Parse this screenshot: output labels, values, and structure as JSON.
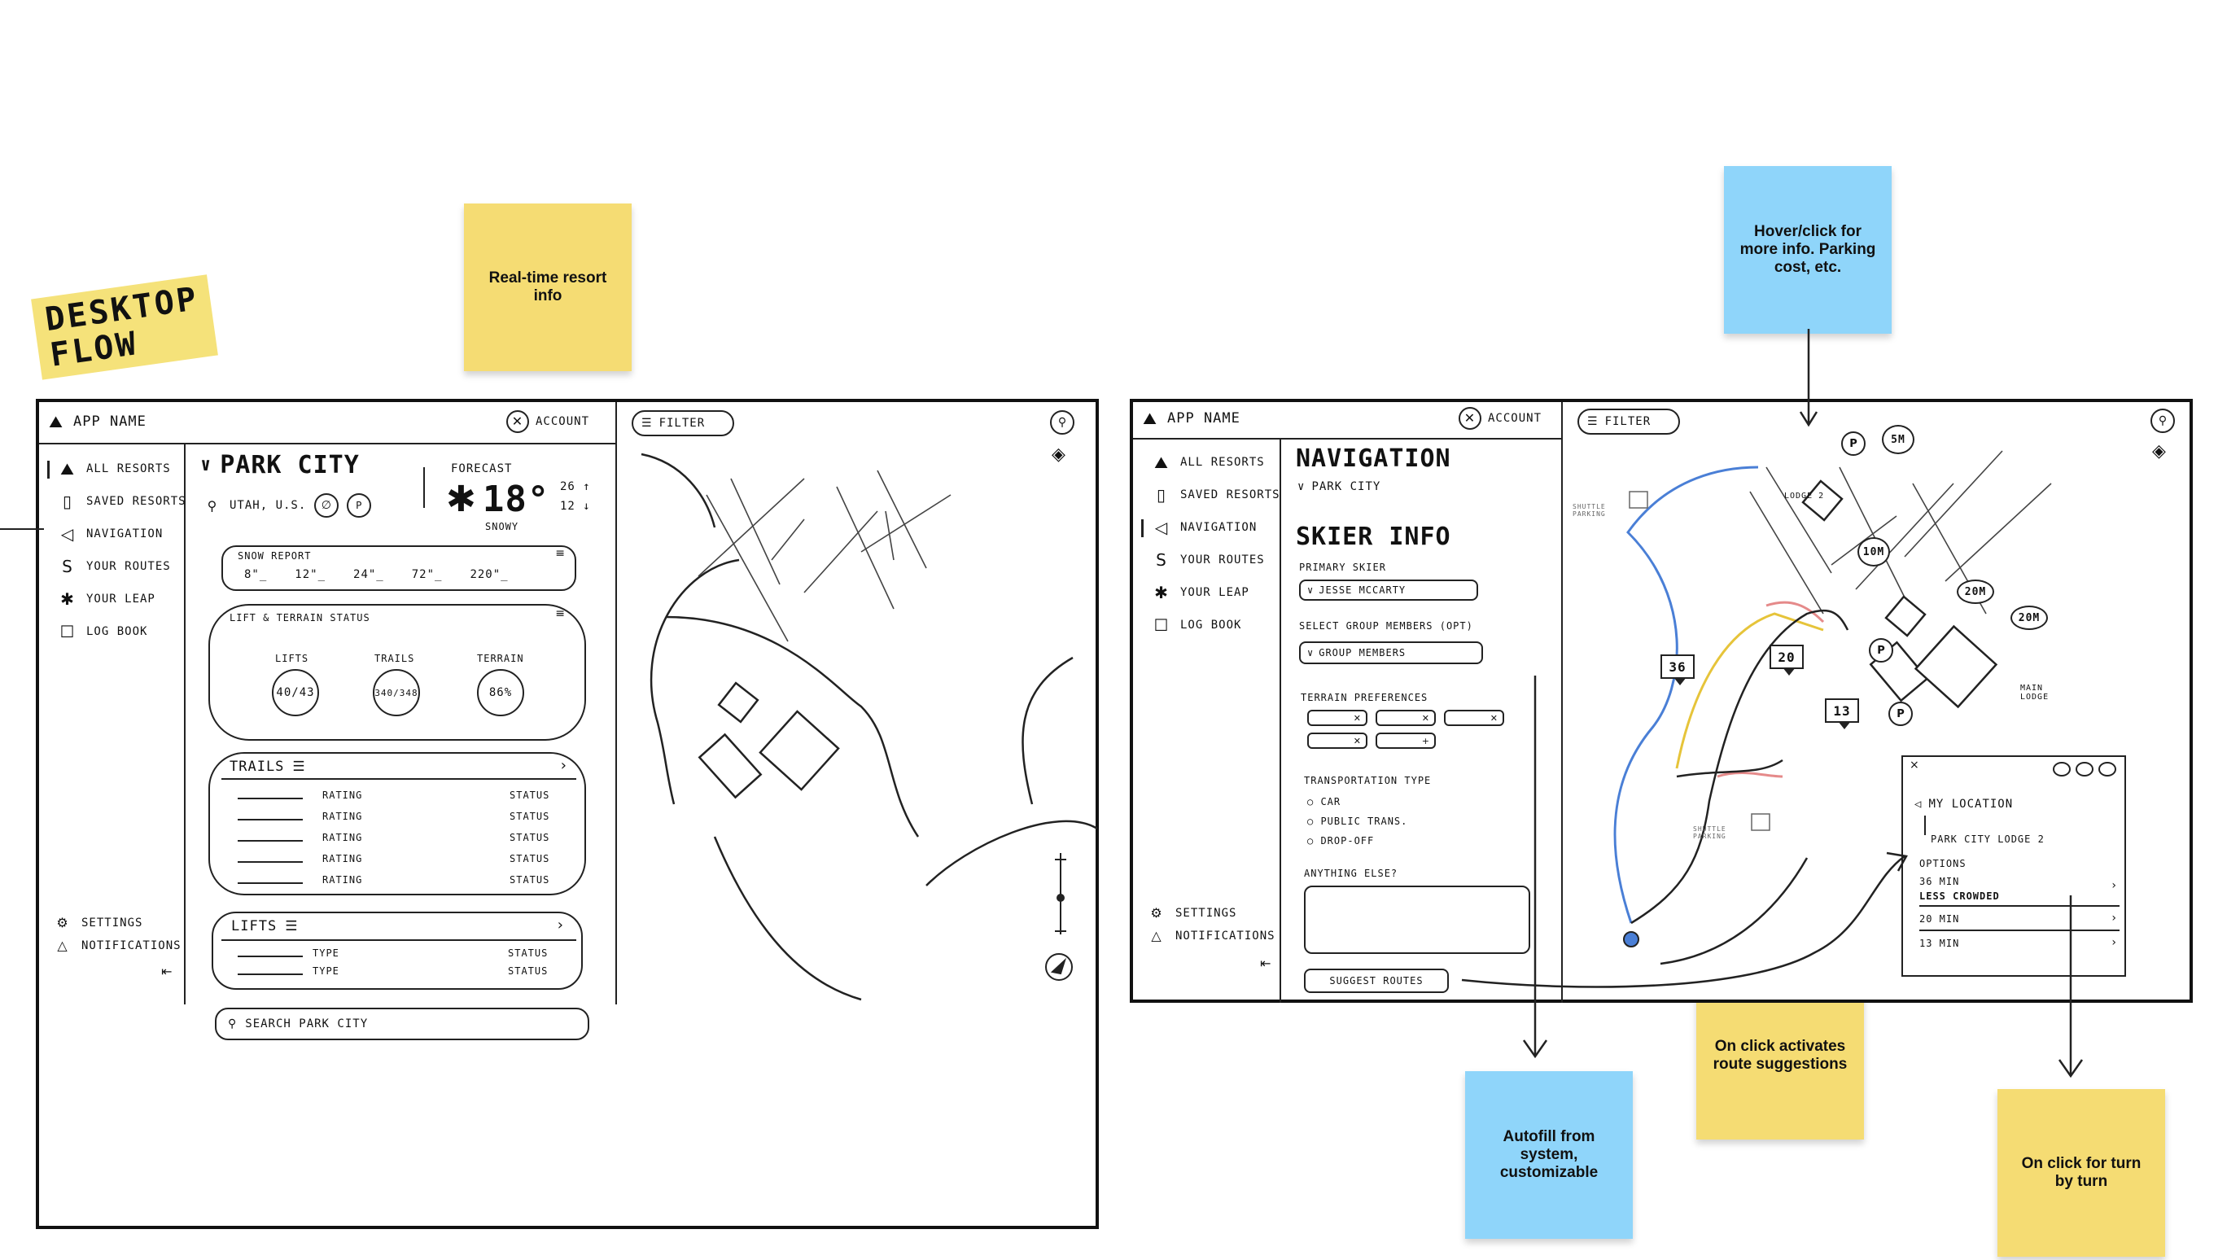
{
  "title": {
    "line1": "DESKTOP",
    "line2": "FLOW"
  },
  "sticky_notes": {
    "realtime": "Real-time resort info",
    "hover": "Hover/click for more info. Parking cost, etc.",
    "autofill": "Autofill from system, customizable",
    "route": "On click activates route suggestions",
    "turn": "On click for turn by turn"
  },
  "colors": {
    "sticky_yellow": "#f5dc73",
    "sticky_blue": "#8fd5fa",
    "route_blue": "#4a7fd6",
    "route_yellow": "#e6c43a",
    "route_red": "#e58a8a"
  },
  "screen1": {
    "app_name": "APP NAME",
    "account": "ACCOUNT",
    "filter": "FILTER",
    "nav": [
      {
        "icon": "mountains-icon",
        "label": "ALL RESORTS"
      },
      {
        "icon": "bookmark-icon",
        "label": "SAVED RESORTS"
      },
      {
        "icon": "navigation-arrow-icon",
        "label": "NAVIGATION"
      },
      {
        "icon": "route-icon",
        "label": "YOUR ROUTES"
      },
      {
        "icon": "gondola-icon",
        "label": "YOUR LEAP"
      },
      {
        "icon": "logbook-icon",
        "label": "LOG BOOK"
      }
    ],
    "settings": "SETTINGS",
    "notifications": "NOTIFICATIONS",
    "resort_name": "PARK CITY",
    "resort_location": "UTAH, U.S.",
    "forecast_label": "FORECAST",
    "temperature": "18°",
    "weather": "SNOWY",
    "forecast_high": "26",
    "forecast_low": "12",
    "snow_report": {
      "title": "SNOW REPORT",
      "values": [
        "8\"_",
        "12\"_",
        "24\"_",
        "72\"_",
        "220\"_"
      ]
    },
    "lift_terrain": {
      "title": "LIFT & TERRAIN STATUS",
      "items": [
        {
          "label": "LIFTS",
          "value": "40/43"
        },
        {
          "label": "TRAILS",
          "value": "340/348"
        },
        {
          "label": "TERRAIN",
          "value": "86%"
        }
      ]
    },
    "trails": {
      "title": "TRAILS",
      "rows": [
        {
          "rating": "RATING",
          "status": "STATUS"
        },
        {
          "rating": "RATING",
          "status": "STATUS"
        },
        {
          "rating": "RATING",
          "status": "STATUS"
        },
        {
          "rating": "RATING",
          "status": "STATUS"
        },
        {
          "rating": "RATING",
          "status": "STATUS"
        }
      ]
    },
    "lifts": {
      "title": "LIFTS",
      "rows": [
        {
          "type": "TYPE",
          "status": "STATUS"
        },
        {
          "type": "TYPE",
          "status": "STATUS"
        }
      ]
    },
    "search_placeholder": "SEARCH PARK CITY"
  },
  "screen2": {
    "app_name": "APP NAME",
    "account": "ACCOUNT",
    "filter": "FILTER",
    "nav": [
      {
        "icon": "mountains-icon",
        "label": "ALL RESORTS"
      },
      {
        "icon": "bookmark-icon",
        "label": "SAVED RESORTS"
      },
      {
        "icon": "navigation-arrow-icon",
        "label": "NAVIGATION"
      },
      {
        "icon": "route-icon",
        "label": "YOUR ROUTES"
      },
      {
        "icon": "gondola-icon",
        "label": "YOUR LEAP"
      },
      {
        "icon": "logbook-icon",
        "label": "LOG BOOK"
      }
    ],
    "settings": "SETTINGS",
    "notifications": "NOTIFICATIONS",
    "page_title": "NAVIGATION",
    "resort": "PARK CITY",
    "skier_info": "SKIER INFO",
    "primary_skier_label": "PRIMARY SKIER",
    "primary_skier_value": "JESSE MCCARTY",
    "group_label": "SELECT GROUP MEMBERS (OPT)",
    "group_value": "GROUP MEMBERS",
    "terrain_label": "TERRAIN PREFERENCES",
    "terrain_add": "+",
    "transport_label": "TRANSPORTATION TYPE",
    "transport_options": [
      "CAR",
      "PUBLIC TRANS.",
      "DROP-OFF"
    ],
    "anything_else": "ANYTHING ELSE?",
    "suggest_button": "SUGGEST ROUTES",
    "map": {
      "parking_label": "P",
      "time_labels": [
        "5m",
        "10m",
        "20m",
        "20m"
      ],
      "lodge2": "LODGE 2",
      "main_lodge": "MAIN LODGE",
      "shuttle1": "SHUTTLE PARKING",
      "shuttle2": "SHUTTLE PARKING",
      "route_times": [
        "36",
        "20",
        "13"
      ]
    },
    "route_panel": {
      "close": "×",
      "from": "MY LOCATION",
      "to": "PARK CITY LODGE 2",
      "options_label": "OPTIONS",
      "options": [
        {
          "time": "36 MIN",
          "note": "LESS CROWDED"
        },
        {
          "time": "20 MIN",
          "note": ""
        },
        {
          "time": "13 MIN",
          "note": ""
        }
      ]
    }
  }
}
